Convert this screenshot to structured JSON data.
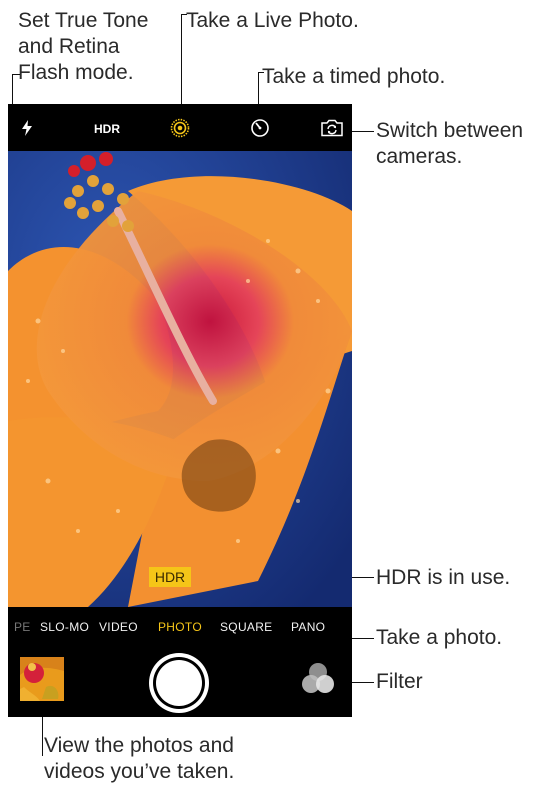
{
  "callouts": {
    "flash": "Set True Tone\nand Retina\nFlash mode.",
    "live_photo": "Take a Live Photo.",
    "timer": "Take a timed photo.",
    "switch_camera": "Switch between\ncameras.",
    "hdr_in_use": "HDR is in use.",
    "take_photo": "Take a photo.",
    "filter": "Filter",
    "view_photos": "View the photos and\nvideos you’ve taken."
  },
  "topbar": {
    "hdr_label": "HDR",
    "icons": [
      "flash-icon",
      "live-photo-icon",
      "timer-icon",
      "switch-camera-icon"
    ]
  },
  "viewfinder": {
    "hdr_badge": "HDR"
  },
  "modes": {
    "items": [
      "PE",
      "SLO-MO",
      "VIDEO",
      "PHOTO",
      "SQUARE",
      "PANO"
    ],
    "selected": "PHOTO"
  },
  "colors": {
    "accent": "#f5c518",
    "background": "#000000",
    "sky": "#1f3f8f",
    "petal": "#f28a2b"
  }
}
